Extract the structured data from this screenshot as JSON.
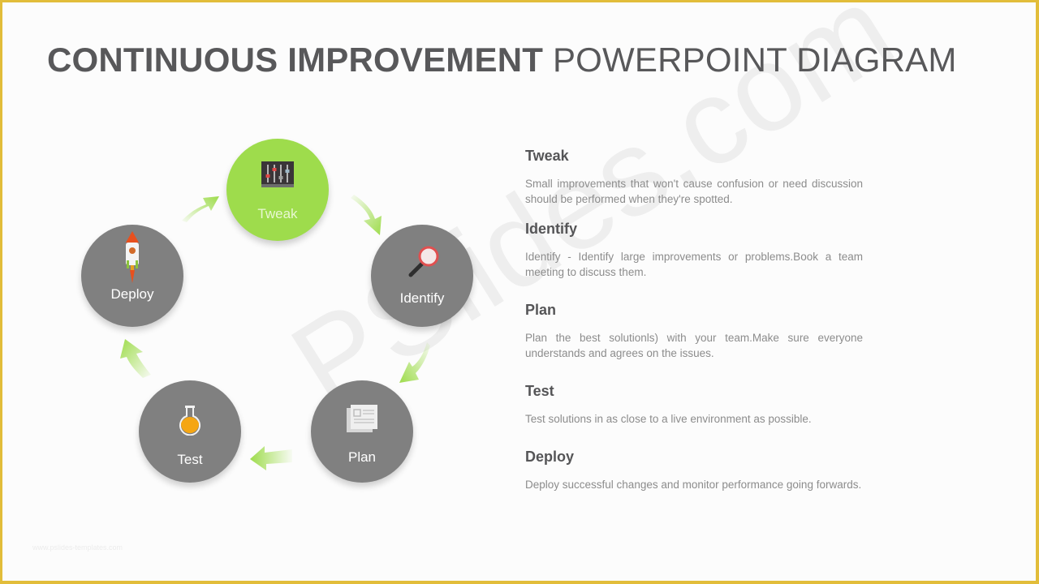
{
  "slide": {
    "title_bold": "CONTINUOUS IMPROVEMENT",
    "title_light": "POWERPOINT DIAGRAM",
    "watermark": "PSlides.com",
    "footer_mark": "www.pslides-templates.com"
  },
  "colors": {
    "accent": "#9edc4c",
    "node": "#808080",
    "frame": "#e2bd3a",
    "title": "#58585a",
    "body_text": "#8c8c8c"
  },
  "cycle": {
    "nodes": [
      {
        "id": "tweak",
        "label": "Tweak",
        "icon": "sliders-icon",
        "active": true
      },
      {
        "id": "identify",
        "label": "Identify",
        "icon": "magnifier-icon",
        "active": false
      },
      {
        "id": "plan",
        "label": "Plan",
        "icon": "document-icon",
        "active": false
      },
      {
        "id": "test",
        "label": "Test",
        "icon": "flask-icon",
        "active": false
      },
      {
        "id": "deploy",
        "label": "Deploy",
        "icon": "rocket-icon",
        "active": false
      }
    ],
    "arrow_direction": "clockwise"
  },
  "descriptions": [
    {
      "heading": "Tweak",
      "text": "Small improvements that won't cause confusion or need discussion should be performed  when they're spotted."
    },
    {
      "heading": "Identify",
      "text": "Identify - Identify large improvements or problems.Book a team meeting to discuss them."
    },
    {
      "heading": "Plan",
      "text": "Plan the best solutionls) with your team.Make  sure everyone understands and agrees on the issues."
    },
    {
      "heading": "Test",
      "text": "Test solutions in as close to a live environment  as possible."
    },
    {
      "heading": "Deploy",
      "text": "Deploy successful changes and monitor performance  going forwards."
    }
  ]
}
